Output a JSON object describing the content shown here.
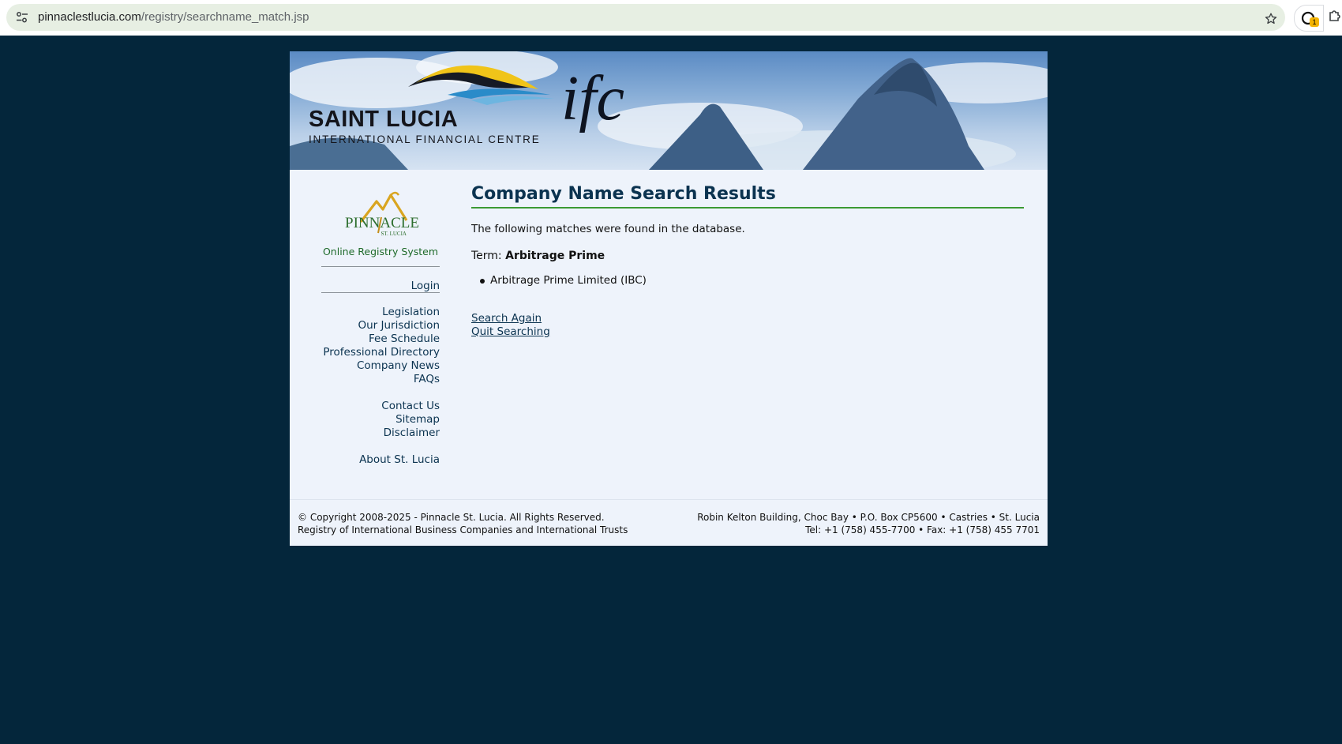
{
  "browser": {
    "url_host": "pinnaclestlucia.com",
    "url_path": "/registry/searchname_match.jsp",
    "extension_badge": "1"
  },
  "banner": {
    "brand_name": "SAINT LUCIA",
    "brand_subtitle": "INTERNATIONAL FINANCIAL CENTRE",
    "brand_mark": "ifc"
  },
  "sidebar": {
    "logo_text": "PINNACLE",
    "logo_subtext": "ST. LUCIA",
    "system_title": "Online Registry System",
    "login": "Login",
    "links_group1": [
      "Legislation",
      "Our Jurisdiction",
      "Fee Schedule",
      "Professional Directory",
      "Company News",
      "FAQs"
    ],
    "links_group2": [
      "Contact Us",
      "Sitemap",
      "Disclaimer"
    ],
    "links_group3": [
      "About St. Lucia"
    ]
  },
  "main": {
    "title": "Company Name Search Results",
    "intro": "The following matches were found in the database.",
    "term_label": "Term:",
    "term_value": "Arbitrage Prime",
    "results": [
      "Arbitrage Prime Limited (IBC)"
    ],
    "search_again": "Search Again",
    "quit_searching": "Quit Searching"
  },
  "footer": {
    "copyright": "© Copyright 2008-2025 - Pinnacle St. Lucia. All Rights Reserved.",
    "registry_line": "Registry of International Business Companies and International Trusts",
    "address": "Robin Kelton Building, Choc Bay • P.O. Box CP5600 • Castries • St. Lucia",
    "phones": "Tel: +1 (758) 455-7700 • Fax: +1 (758) 455 7701"
  },
  "colors": {
    "page_background": "#04263b",
    "heading": "#0b3350",
    "accent_rule": "#3b9a33",
    "registry_title": "#1e6a2a"
  }
}
